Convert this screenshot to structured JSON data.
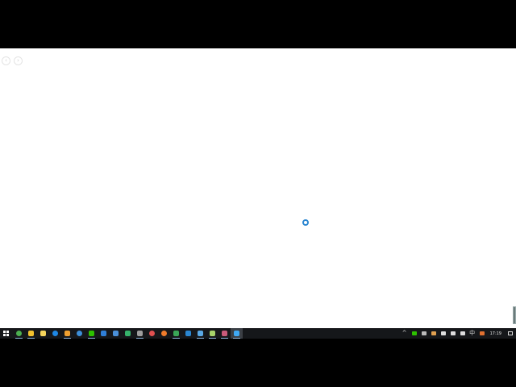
{
  "browser": {
    "back_icon": "back-arrow-icon",
    "forward_icon": "forward-arrow-icon",
    "back_glyph": "‹",
    "forward_glyph": "›"
  },
  "loading": {
    "icon": "loading-spinner-icon",
    "color": "#2a86d1"
  },
  "taskbar": {
    "start_icon": "windows-logo-icon",
    "apps": [
      {
        "icon": "chrome-icon",
        "color": "#4caf50",
        "running": true,
        "active": false
      },
      {
        "icon": "sticky-notes-icon",
        "color": "#f2c12e",
        "running": true,
        "active": false
      },
      {
        "icon": "file-explorer-icon",
        "color": "#f6d55c",
        "running": false,
        "active": false
      },
      {
        "icon": "edge-icon",
        "color": "#1e88e5",
        "running": false,
        "active": false
      },
      {
        "icon": "notes-app-icon",
        "color": "#f0a030",
        "running": true,
        "active": false
      },
      {
        "icon": "browser-icon",
        "color": "#3d8ed8",
        "running": false,
        "active": false
      },
      {
        "icon": "wechat-icon",
        "color": "#2dc100",
        "running": true,
        "active": false
      },
      {
        "icon": "app-blue-icon",
        "color": "#2f7fd8",
        "running": false,
        "active": false
      },
      {
        "icon": "mail-icon",
        "color": "#4a90d9",
        "running": false,
        "active": false
      },
      {
        "icon": "media-player-icon",
        "color": "#36b36b",
        "running": false,
        "active": false
      },
      {
        "icon": "calculator-icon",
        "color": "#9e9e9e",
        "running": true,
        "active": false
      },
      {
        "icon": "red-app-icon",
        "color": "#e05050",
        "running": false,
        "active": false
      },
      {
        "icon": "firefox-icon",
        "color": "#ef7b2b",
        "running": false,
        "active": false
      },
      {
        "icon": "green-app-icon",
        "color": "#3aa757",
        "running": true,
        "active": false
      },
      {
        "icon": "blue-app-icon",
        "color": "#2a86d1",
        "running": false,
        "active": false
      },
      {
        "icon": "document-icon",
        "color": "#5aa9e6",
        "running": true,
        "active": false
      },
      {
        "icon": "spreadsheet-icon",
        "color": "#a7d36a",
        "running": true,
        "active": false
      },
      {
        "icon": "photo-app-icon",
        "color": "#c85a7a",
        "running": true,
        "active": false
      },
      {
        "icon": "ie-browser-icon",
        "color": "#3fa9f5",
        "running": true,
        "active": true
      }
    ],
    "tray": [
      {
        "icon": "chevron-up-icon",
        "glyph": "^",
        "color": ""
      },
      {
        "icon": "wechat-tray-icon",
        "glyph": "",
        "color": "#2dc100"
      },
      {
        "icon": "network-status-icon",
        "glyph": "",
        "color": "#bbbbbb"
      },
      {
        "icon": "app-tray-icon",
        "glyph": "",
        "color": "#e0a050"
      },
      {
        "icon": "speaker-icon",
        "glyph": "",
        "color": "#dddddd"
      },
      {
        "icon": "battery-icon",
        "glyph": "",
        "color": "#dddddd"
      },
      {
        "icon": "keyboard-icon",
        "glyph": "",
        "color": "#dddddd"
      },
      {
        "icon": "ime-icon",
        "glyph": "中",
        "color": ""
      },
      {
        "icon": "input-method-icon",
        "glyph": "",
        "color": "#e07030"
      }
    ],
    "clock": "17:19",
    "notification_icon": "notification-center-icon"
  }
}
